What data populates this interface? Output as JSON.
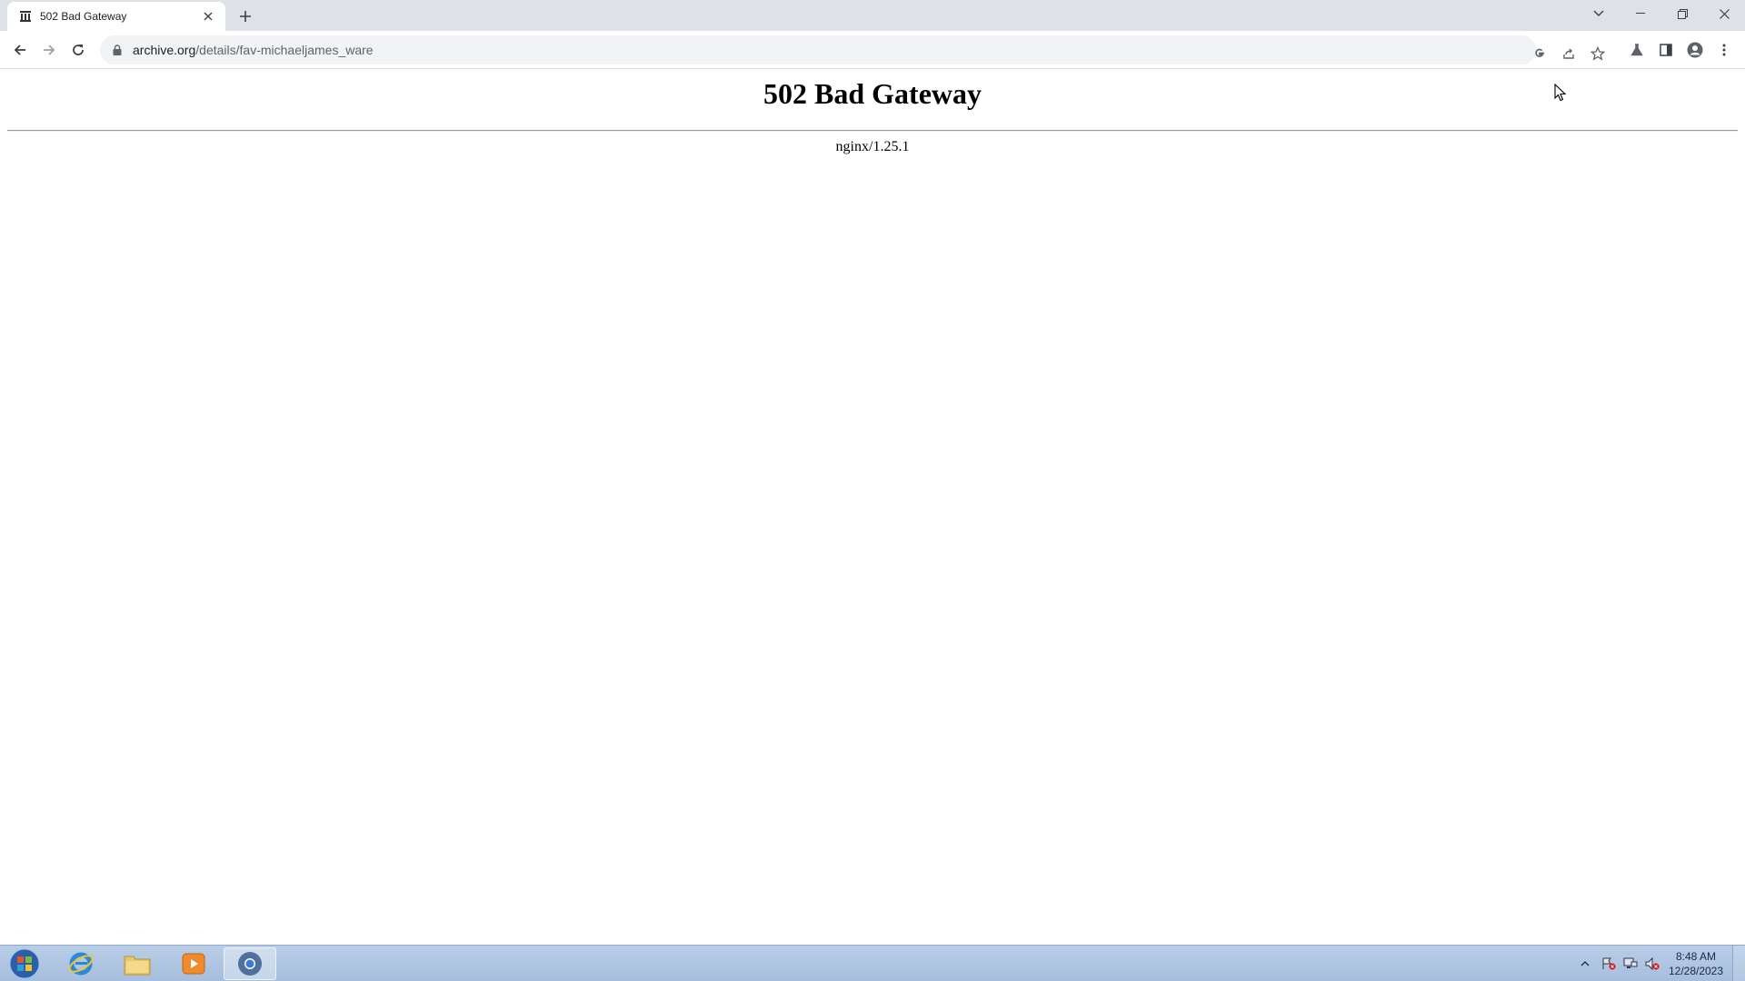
{
  "browser": {
    "tab": {
      "title": "502 Bad Gateway",
      "favicon": "archive-icon"
    },
    "new_tab_symbol": "+",
    "address": {
      "host": "archive.org",
      "path": "/details/fav-michaeljames_ware"
    }
  },
  "page": {
    "heading": "502 Bad Gateway",
    "server": "nginx/1.25.1"
  },
  "taskbar": {
    "apps": [
      "internet-explorer-icon",
      "file-explorer-icon",
      "media-player-icon",
      "chrome-icon"
    ],
    "active_app": "chrome-icon",
    "clock": {
      "time": "8:48 AM",
      "date": "12/28/2023"
    }
  },
  "colors": {
    "tabstrip": "#dee1e6",
    "omnibox": "#f1f3f4",
    "taskbar": "#b9cde6"
  }
}
